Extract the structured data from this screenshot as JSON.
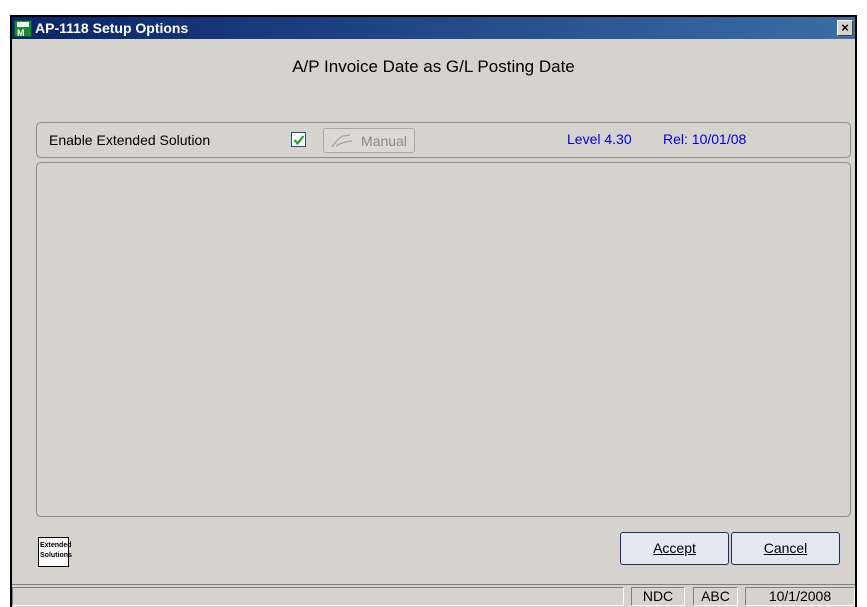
{
  "window": {
    "title": "AP-1118 Setup Options",
    "close_label": "×"
  },
  "heading": "A/P Invoice Date as G/L Posting Date",
  "options": {
    "enable_label": "Enable Extended Solution",
    "enable_checked": true,
    "manual_label": "Manual",
    "level": "Level 4.30",
    "release": "Rel: 10/01/08"
  },
  "logo": {
    "line1": "Extended",
    "line2": "Solutions"
  },
  "buttons": {
    "accept_label": "Accept",
    "cancel_label": "Cancel"
  },
  "statusbar": {
    "main": "",
    "company_code": "NDC",
    "user": "ABC",
    "date": "10/1/2008"
  },
  "colors": {
    "title_bar": "#0a246a",
    "info_text": "#0000e0",
    "window_bg": "#d6d3ce"
  }
}
